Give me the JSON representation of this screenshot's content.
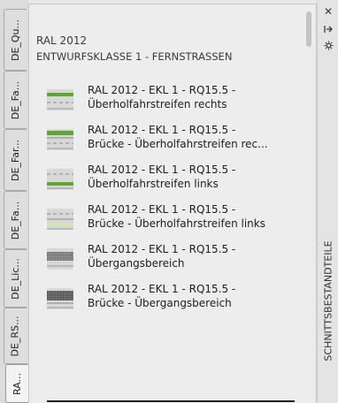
{
  "left_tabs": [
    {
      "label": "DE_Qu..."
    },
    {
      "label": "DE_Fa..."
    },
    {
      "label": "DE_Far..."
    },
    {
      "label": "DE_Fa..."
    },
    {
      "label": "DE_Lic..."
    },
    {
      "label": "DE_RS..."
    },
    {
      "label": "RA..."
    }
  ],
  "panel": {
    "title": "RAL 2012",
    "section": "ENTWURFSKLASSE 1 - FERNSTRASSEN",
    "items": [
      {
        "line1": "RAL 2012 - EKL 1 - RQ15.5 -",
        "line2": "Überholfahrstreifen rechts",
        "icon": "lane-overtaking-right-icon"
      },
      {
        "line1": "RAL 2012 - EKL 1 - RQ15.5 -",
        "line2": "Brücke - Überholfahrstreifen rec...",
        "icon": "bridge-lane-overtaking-right-icon"
      },
      {
        "line1": "RAL 2012 - EKL 1 - RQ15.5 -",
        "line2": "Überholfahrstreifen links",
        "icon": "lane-overtaking-left-icon"
      },
      {
        "line1": "RAL 2012 - EKL 1 - RQ15.5 -",
        "line2": "Brücke - Überholfahrstreifen links",
        "icon": "bridge-lane-overtaking-left-icon"
      },
      {
        "line1": "RAL 2012 - EKL 1 - RQ15.5 -",
        "line2": "Übergangsbereich",
        "icon": "transition-zone-icon"
      },
      {
        "line1": "RAL 2012 - EKL 1 - RQ15.5 -",
        "line2": "Brücke - Übergangsbereich",
        "icon": "bridge-transition-zone-icon"
      }
    ]
  },
  "right_strip": {
    "vertical_label": "SCHNITTSBESTANDTEILE",
    "buttons": [
      "close-icon",
      "auto-hide-icon",
      "properties-icon"
    ]
  },
  "colors": {
    "panel_bg": "#ededed",
    "tab_bg": "#dedede",
    "green_lane": "#5aa832",
    "light_green_fill": "#cfe8b0"
  }
}
